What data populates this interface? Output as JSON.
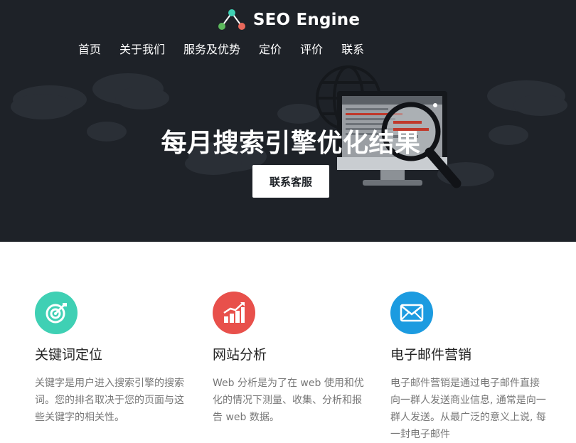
{
  "brand": {
    "name": "SEO Engine",
    "logo_icon": "three-node-graph-icon"
  },
  "nav": {
    "items": [
      "首页",
      "关于我们",
      "服务及优势",
      "定价",
      "评价",
      "联系"
    ]
  },
  "hero": {
    "title": "每月搜索引擎优化结果",
    "cta_label": "联系客服",
    "illustration": "monitor-magnifier-icon"
  },
  "features": [
    {
      "icon": "target-icon",
      "color": "#3fd0b4",
      "title": "关键词定位",
      "desc": "关键字是用户进入搜索引擎的搜索词。您的排名取决于您的页面与这些关键字的相关性。"
    },
    {
      "icon": "bar-chart-icon",
      "color": "#e8504b",
      "title": "网站分析",
      "desc": "Web 分析是为了在 web 使用和优化的情况下测量、收集、分析和报告 web 数据。"
    },
    {
      "icon": "envelope-icon",
      "color": "#1c9be0",
      "title": "电子邮件营销",
      "desc": "电子邮件营销是通过电子邮件直接向一群人发送商业信息, 通常是向一群人发送。从最广泛的意义上说, 每一封电子邮件"
    }
  ],
  "colors": {
    "hero_bg": "#1e2228",
    "accent_teal": "#3fd0b4",
    "accent_red": "#e8504b",
    "accent_blue": "#1c9be0"
  }
}
